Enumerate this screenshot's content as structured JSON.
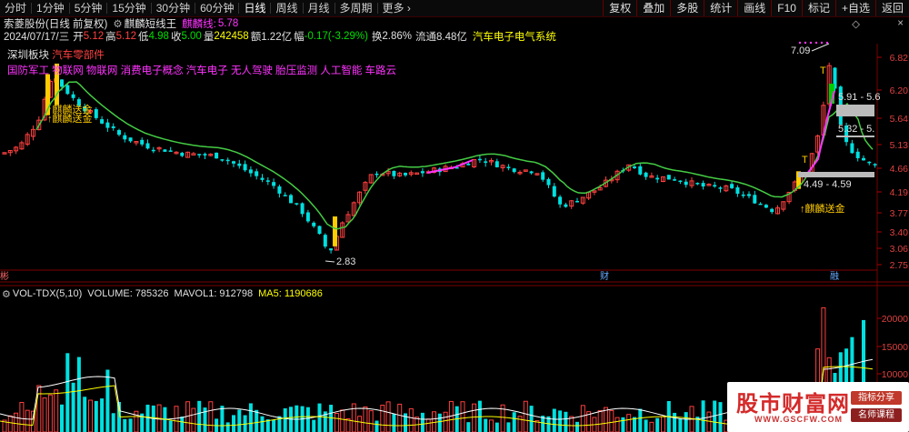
{
  "toolbar": {
    "tabs": [
      "分时",
      "1分钟",
      "5分钟",
      "15分钟",
      "30分钟",
      "60分钟",
      "日线",
      "周线",
      "月线",
      "多周期",
      "更多"
    ],
    "active_tab": "日线",
    "right_buttons": [
      "复权",
      "叠加",
      "多股",
      "统计",
      "画线",
      "F10",
      "标记",
      "+自选",
      "返回"
    ]
  },
  "header": {
    "stock_name": "索菱股份(日线 前复权)",
    "indicator_name": "麒麟短线王",
    "indicator_value_label": "麒麟线:",
    "indicator_value": "5.78",
    "date": "2024/07/17/三",
    "open_label": "开",
    "open": "5.12",
    "high_label": "高",
    "high": "5.12",
    "low_label": "低",
    "low": "4.98",
    "close_label": "收",
    "close": "5.00",
    "volume_label": "量",
    "volume": "242458",
    "amount_label": "额",
    "amount": "1.22亿",
    "change_label": "幅",
    "change": "-0.17(-3.29%)",
    "turnover_label": "换",
    "turnover": "2.86%",
    "float_label": "流通",
    "float": "8.48亿",
    "sector": "汽车电子电气系统"
  },
  "tags": {
    "board_label": "深圳板块",
    "board_hot": "汽车零部件",
    "concepts": "国防军工 物联网 物联网 消费电子概念 汽车电子 无人驾驶 胎压监测 人工智能 车路云"
  },
  "chart_data": {
    "type": "candlestick",
    "y_ticks": [
      "6.82",
      "6.20",
      "5.64",
      "5.13",
      "4.66",
      "4.19",
      "3.77",
      "3.40",
      "3.06",
      "2.75"
    ],
    "annotations": {
      "high_mark": "7.09",
      "low_mark": "2.83",
      "signal_text": "麒麟送金",
      "band_upper": "5.91 - 5.6",
      "band_mid": "5.32 - 5.",
      "band_lower": "4.49 - 4.59",
      "marker_t": "T",
      "marker_cai": "财",
      "marker_rong": "融",
      "marker_bian": "彬"
    },
    "vol_y_ticks": [
      "20000",
      "15000",
      "10000"
    ]
  },
  "volume_panel": {
    "title": "VOL-TDX(5,10)",
    "volume_label": "VOLUME:",
    "volume": "785326",
    "mavol_label": "MAVOL1:",
    "mavol": "912798",
    "ma5_label": "MA5:",
    "ma5": "1190686"
  },
  "logo": {
    "title": "股市财富网",
    "url": "WWW.GSCFW.COM",
    "tag1": "指标分享",
    "tag2": "名师课程"
  },
  "colors": {
    "up": "#ff4040",
    "down": "#00e0e0",
    "ma": "#44cc44",
    "signal": "#ffcc00",
    "line": "#ff33ff"
  }
}
